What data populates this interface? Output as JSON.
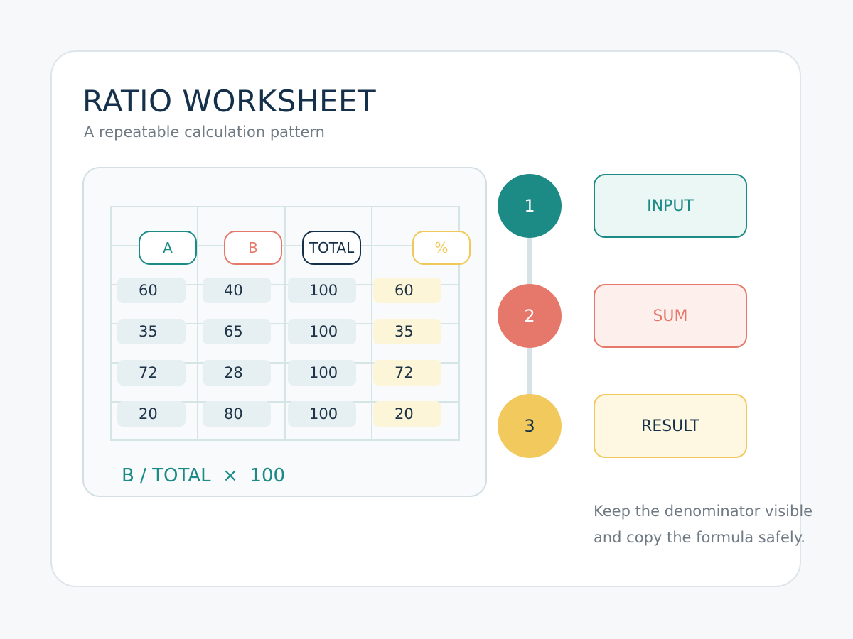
{
  "header": {
    "title": "RATIO WORKSHEET",
    "subtitle": "A repeatable calculation pattern"
  },
  "worksheet": {
    "columns": [
      {
        "label": "A",
        "color": "#1c8a85"
      },
      {
        "label": "B",
        "color": "#e5786a"
      },
      {
        "label": "TOTAL",
        "color": "#15304a"
      },
      {
        "label": "%",
        "color": "#f0c95a"
      }
    ],
    "rows": [
      [
        "60",
        "40",
        "100",
        "60"
      ],
      [
        "35",
        "65",
        "100",
        "35"
      ],
      [
        "72",
        "28",
        "100",
        "72"
      ],
      [
        "20",
        "80",
        "100",
        "20"
      ]
    ],
    "formula": "B / TOTAL  ×  100"
  },
  "steps": [
    {
      "number": "1",
      "label": "INPUT",
      "color": "#1c8a85",
      "fill": "#ebf7f5",
      "text_color": "#1c8a85"
    },
    {
      "number": "2",
      "label": "SUM",
      "color": "#e5786a",
      "fill": "#fdefec",
      "text_color": "#e5786a"
    },
    {
      "number": "3",
      "label": "RESULT",
      "color": "#f2c95c",
      "fill": "#fef7e1",
      "text_color": "#15304a"
    }
  ],
  "note": {
    "line1": "Keep the denominator visible",
    "line2": "and copy the formula safely."
  }
}
